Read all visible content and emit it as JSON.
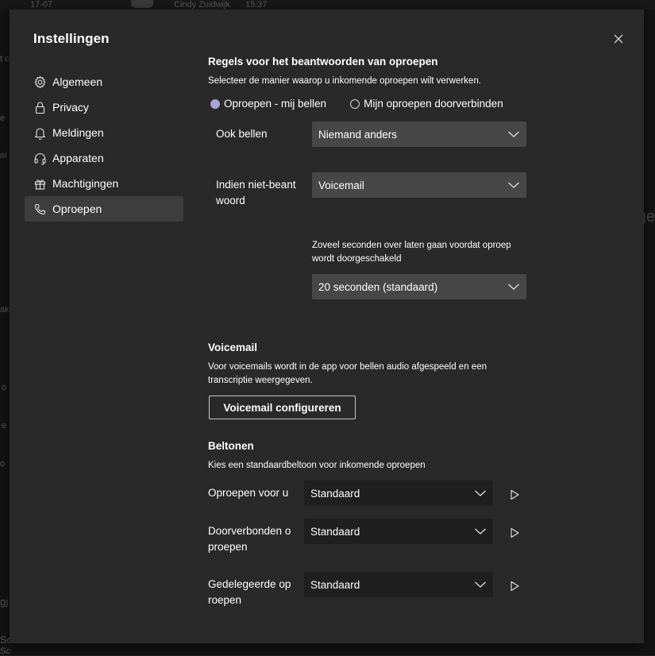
{
  "background": {
    "date": "17-07",
    "sender": "Cindy Zuidwijk",
    "time": "15:37",
    "fragments": [
      "t c",
      "e",
      "oi c",
      "ge",
      "ak",
      "o",
      "e",
      "o",
      "gj",
      "Sc",
      "Sc",
      "ttps://w"
    ]
  },
  "dialog": {
    "title": "Instellingen",
    "close_icon": "close-icon"
  },
  "sidebar": {
    "items": [
      {
        "label": "Algemeen",
        "icon": "gear-icon",
        "active": false
      },
      {
        "label": "Privacy",
        "icon": "lock-icon",
        "active": false
      },
      {
        "label": "Meldingen",
        "icon": "bell-icon",
        "active": false
      },
      {
        "label": "Apparaten",
        "icon": "headset-icon",
        "active": false
      },
      {
        "label": "Machtigingen",
        "icon": "gift-icon",
        "active": false
      },
      {
        "label": "Oproepen",
        "icon": "phone-icon",
        "active": true
      }
    ]
  },
  "call_rules": {
    "heading": "Regels voor het beantwoorden van oproepen",
    "description": "Selecteer de manier waarop u inkomende oproepen wilt verwerken.",
    "options": [
      {
        "label": "Oproepen - mij bellen",
        "selected": true
      },
      {
        "label": "Mijn oproepen doorverbinden",
        "selected": false
      }
    ],
    "also_ring_label": "Ook bellen",
    "also_ring_value": "Niemand anders",
    "unanswered_label_line1": "Indien niet-beant",
    "unanswered_label_line2": "woord",
    "unanswered_value": "Voicemail",
    "seconds_description_line1": "Zoveel seconden over laten gaan voordat oproep",
    "seconds_description_line2": "wordt doorgeschakeld",
    "seconds_value": "20 seconden (standaard)"
  },
  "voicemail": {
    "heading": "Voicemail",
    "description_line1": "Voor voicemails wordt in de app voor bellen audio afgespeeld en een",
    "description_line2": "transcriptie weergegeven.",
    "configure_button": "Voicemail configureren"
  },
  "ringtones": {
    "heading": "Beltonen",
    "description": "Kies een standaardbeltoon voor inkomende oproepen",
    "rows": [
      {
        "label_line1": "Oproepen voor u",
        "label_line2": "",
        "value": "Standaard"
      },
      {
        "label_line1": "Doorverbonden o",
        "label_line2": "proepen",
        "value": "Standaard"
      },
      {
        "label_line1": "Gedelegeerde op",
        "label_line2": "roepen",
        "value": "Standaard"
      }
    ]
  },
  "colors": {
    "dialog_bg": "#292929",
    "select_bg": "#474747",
    "select_dark_bg": "#1f1f1f",
    "nav_active_bg": "#3d3d3d",
    "radio_accent": "#a7a5d4"
  }
}
